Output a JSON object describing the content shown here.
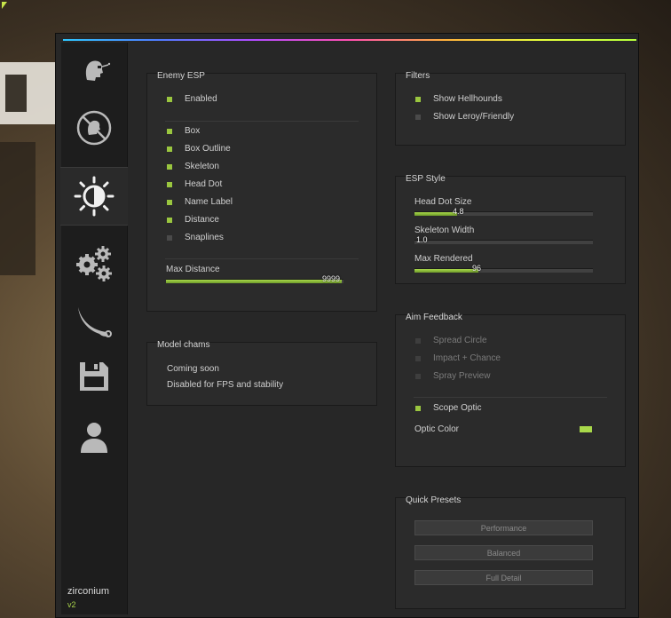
{
  "sidebar": {
    "tabs": [
      {
        "icon": "head-icon"
      },
      {
        "icon": "no-visibility-icon"
      },
      {
        "icon": "brightness-icon",
        "active": true
      },
      {
        "icon": "gears-icon"
      },
      {
        "icon": "knife-icon"
      },
      {
        "icon": "save-icon"
      },
      {
        "icon": "user-icon"
      }
    ],
    "brand_name": "zirconium",
    "brand_version": "v2"
  },
  "enemy_esp": {
    "title": "Enemy ESP",
    "enabled": {
      "label": "Enabled",
      "checked": true
    },
    "items": [
      {
        "label": "Box",
        "checked": true
      },
      {
        "label": "Box Outline",
        "checked": true
      },
      {
        "label": "Skeleton",
        "checked": true
      },
      {
        "label": "Head Dot",
        "checked": true
      },
      {
        "label": "Name Label",
        "checked": true
      },
      {
        "label": "Distance",
        "checked": true
      },
      {
        "label": "Snaplines",
        "checked": false
      }
    ],
    "max_distance": {
      "label": "Max Distance",
      "value": "9999",
      "fill": 0.99
    }
  },
  "model_chams": {
    "title": "Model chams",
    "line1": "Coming soon",
    "line2": "Disabled for FPS and stability"
  },
  "filters": {
    "title": "Filters",
    "items": [
      {
        "label": "Show Hellhounds",
        "checked": true
      },
      {
        "label": "Show Leroy/Friendly",
        "checked": false
      }
    ]
  },
  "esp_style": {
    "title": "ESP Style",
    "sliders": [
      {
        "label": "Head Dot Size",
        "value": "4.8",
        "fill": 0.24
      },
      {
        "label": "Skeleton Width",
        "value": "1.0",
        "fill": 0.0
      },
      {
        "label": "Max Rendered",
        "value": "96",
        "fill": 0.36
      }
    ]
  },
  "aim_feedback": {
    "title": "Aim Feedback",
    "items": [
      {
        "label": "Spread Circle",
        "checked": false,
        "disabled": true
      },
      {
        "label": "Impact + Chance",
        "checked": false,
        "disabled": true
      },
      {
        "label": "Spray Preview",
        "checked": false,
        "disabled": true
      }
    ],
    "scope_optic": {
      "label": "Scope Optic",
      "checked": true
    },
    "optic_color": {
      "label": "Optic Color",
      "color": "#a8d84a"
    }
  },
  "quick_presets": {
    "title": "Quick Presets",
    "buttons": [
      "Performance",
      "Balanced",
      "Full Detail"
    ]
  },
  "colors": {
    "accent": "#9ac63f",
    "panel": "#2b2b2b",
    "window": "#272727"
  }
}
